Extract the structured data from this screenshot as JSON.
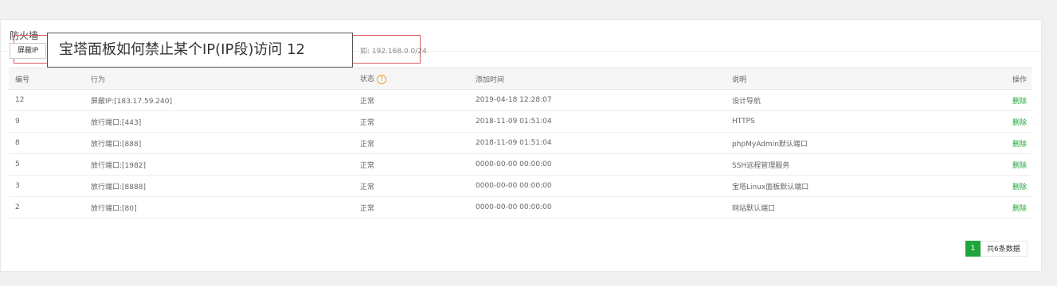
{
  "panel": {
    "title": "防火墙"
  },
  "toolbar": {
    "block_ip_label": "屏蔽IP",
    "hint": "如: 192.168.0.0/24"
  },
  "tooltip": {
    "text": "宝塔面板如何禁止某个IP(IP段)访问 12"
  },
  "table": {
    "headers": {
      "id": "编号",
      "action": "行为",
      "status": "状态",
      "time": "添加时间",
      "note": "说明",
      "ops": "操作"
    },
    "rows": [
      {
        "id": "12",
        "action": "屏蔽IP:[183.17.59.240]",
        "status": "正常",
        "time": "2019-04-18 12:28:07",
        "note": "设计导航",
        "op": "删除"
      },
      {
        "id": "9",
        "action": "放行端口:[443]",
        "status": "正常",
        "time": "2018-11-09 01:51:04",
        "note": "HTTPS",
        "op": "删除"
      },
      {
        "id": "8",
        "action": "放行端口:[888]",
        "status": "正常",
        "time": "2018-11-09 01:51:04",
        "note": "phpMyAdmin默认端口",
        "op": "删除"
      },
      {
        "id": "5",
        "action": "放行端口:[1982]",
        "status": "正常",
        "time": "0000-00-00 00:00:00",
        "note": "SSH远程管理服务",
        "op": "删除"
      },
      {
        "id": "3",
        "action": "放行端口:[8888]",
        "status": "正常",
        "time": "0000-00-00 00:00:00",
        "note": "宝塔Linux面板默认端口",
        "op": "删除"
      },
      {
        "id": "2",
        "action": "放行端口:[80]",
        "status": "正常",
        "time": "0000-00-00 00:00:00",
        "note": "网站默认端口",
        "op": "删除"
      }
    ]
  },
  "pager": {
    "current": "1",
    "total_text": "共6条数据"
  },
  "colors": {
    "accent": "#20a53a",
    "highlight_border": "#d95c5c",
    "help_icon": "#f0a030"
  },
  "icons": {
    "status_help": "question-circle-icon"
  }
}
